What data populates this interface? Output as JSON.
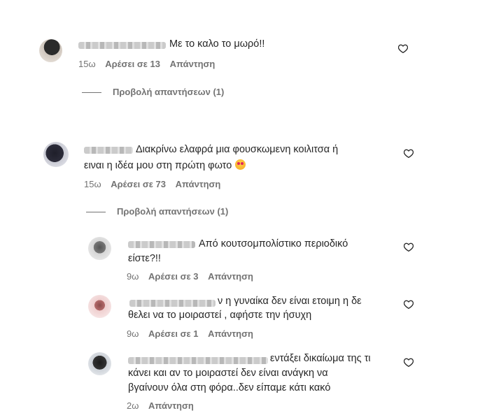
{
  "comments": [
    {
      "text": "Με το καλο το μωρό!!",
      "age": "15ω",
      "likes": "Αρέσει σε 13",
      "reply": "Απάντηση",
      "view_replies": "Προβολή απαντήσεων (1)"
    },
    {
      "text_line1": "Διακρίνω ελαφρά μια φουσκωμενη κοιλιτσα ή",
      "text_line2": "ειναι η ιδέα μου στη πρώτη φωτο",
      "age": "15ω",
      "likes": "Αρέσει σε 73",
      "reply": "Απάντηση",
      "view_replies": "Προβολή απαντήσεων (1)"
    }
  ],
  "replies": [
    {
      "text_line1": "Από κουτσομπολίστικο περιοδικό",
      "text_line2": "είστε?!!",
      "age": "9ω",
      "likes": "Αρέσει σε 3",
      "reply": "Απάντηση"
    },
    {
      "text_line1": "ν η γυναίκα δεν είναι ετοιμη η δε",
      "text_line2": "θελει να το μοιραστεί , αφήστε την ήσυχη",
      "age": "9ω",
      "likes": "Αρέσει σε 1",
      "reply": "Απάντηση"
    },
    {
      "text_line1": "εντάξει δικαίωμα της τι",
      "text_line2": "κάνει και αν το μοιραστεί δεν είναι ανάγκη να",
      "text_line3": "βγαίνουν όλα στη φόρα..δεν είπαμε κάτι κακό",
      "age": "2ω",
      "reply": "Απάντηση"
    }
  ],
  "icons": {
    "like": "heart-outline-icon",
    "emoji": "star-struck-emoji"
  },
  "colors": {
    "text": "#262626",
    "meta": "#737373",
    "background": "#ffffff"
  }
}
